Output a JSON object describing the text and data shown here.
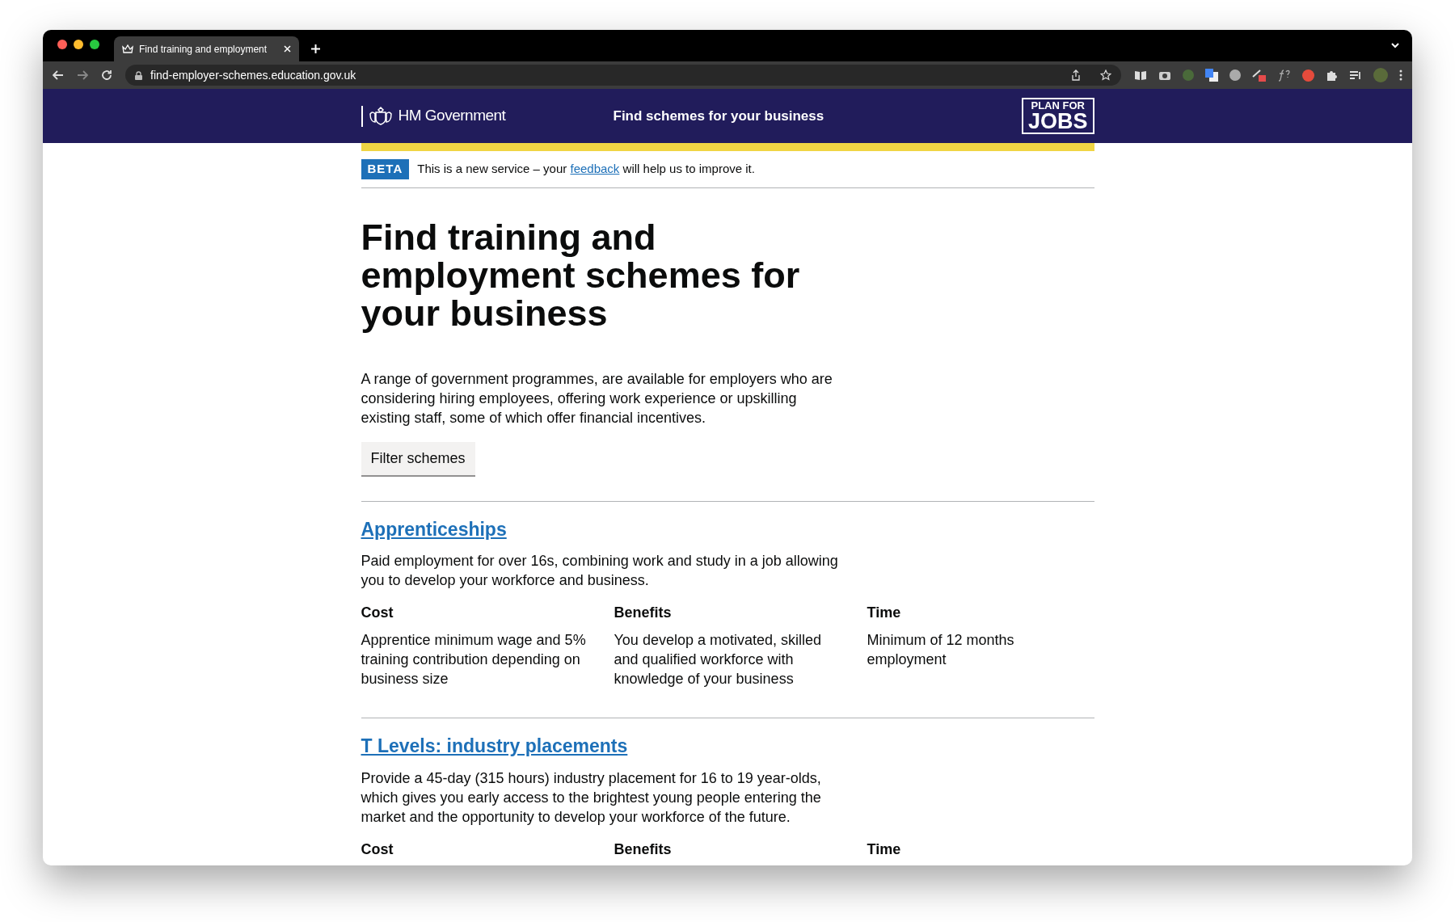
{
  "browser": {
    "tab_title": "Find training and employment",
    "url": "find-employer-schemes.education.gov.uk"
  },
  "header": {
    "brand": "HM Government",
    "service_name": "Find schemes for your business",
    "logo_line1": "PLAN FOR",
    "logo_line2": "JOBS"
  },
  "phase_banner": {
    "tag": "BETA",
    "text_before": "This is a new service – your",
    "link": "feedback",
    "text_after": "will help us to improve it."
  },
  "title": "Find training and employment schemes for your business",
  "intro": "A range of government programmes, are available for employers who are considering hiring employees, offering work experience or upskilling existing staff, some of which offer financial incentives.",
  "filter_button": "Filter schemes",
  "schemes": [
    {
      "title": "Apprenticeships",
      "description": "Paid employment for over 16s, combining work and study in a job allowing you to develop your workforce and business.",
      "columns": [
        {
          "heading": "Cost",
          "text": "Apprentice minimum wage and 5% training contribution depending on business size"
        },
        {
          "heading": "Benefits",
          "text": "You develop a motivated, skilled and qualified workforce with knowledge of your business"
        },
        {
          "heading": "Time",
          "text": "Minimum of 12 months employment"
        }
      ]
    },
    {
      "title": "T Levels: industry placements",
      "description": "Provide a 45-day (315 hours) industry placement for 16 to 19 year-olds, which gives you early access to the brightest young people entering the market and the opportunity to develop your workforce of the future.",
      "columns": [
        {
          "heading": "Cost"
        },
        {
          "heading": "Benefits"
        },
        {
          "heading": "Time"
        }
      ]
    }
  ]
}
